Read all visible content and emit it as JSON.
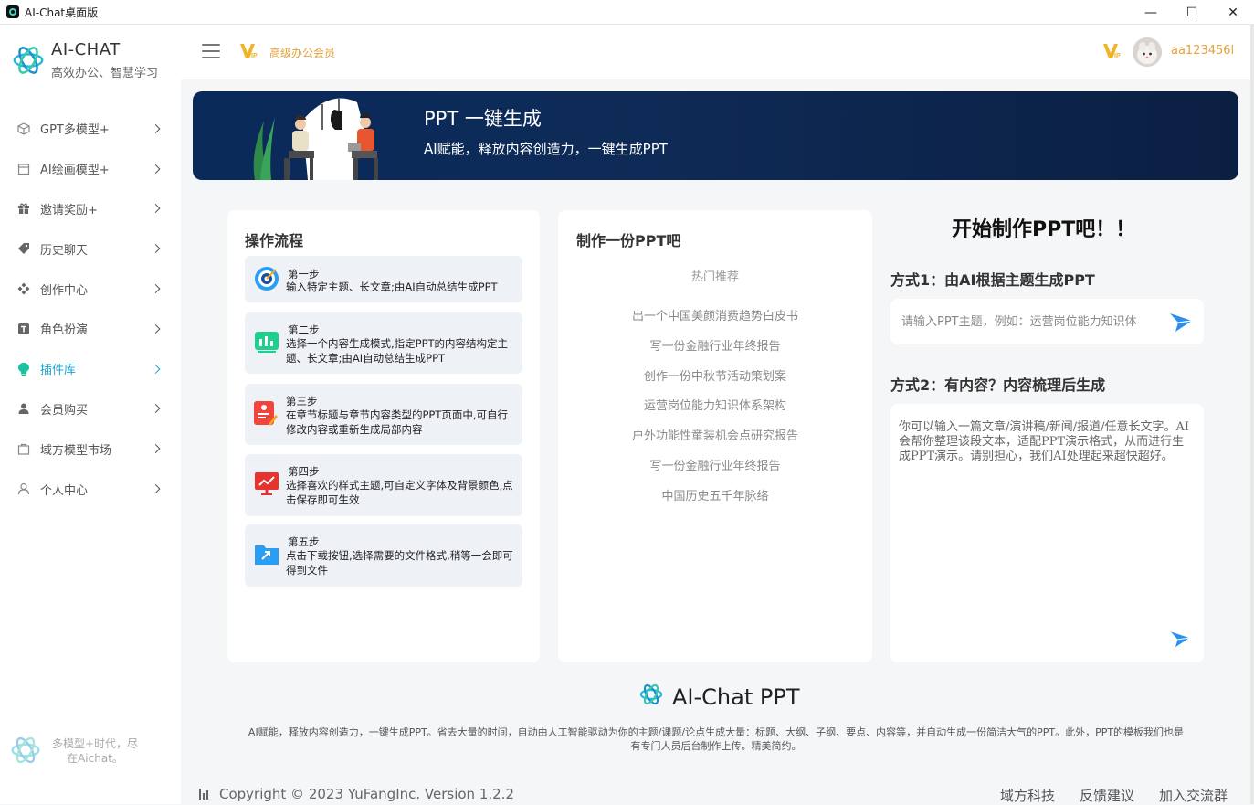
{
  "window": {
    "title": "AI-Chat桌面版",
    "minimize_glyph": "—",
    "maximize_glyph": "☐",
    "close_glyph": "✕"
  },
  "brand": {
    "name": "AI-CHAT",
    "slogan": "高效办公、智慧学习"
  },
  "sidebar": {
    "items": [
      {
        "label": "GPT多模型+",
        "icon": "cube-icon"
      },
      {
        "label": "AI绘画模型+",
        "icon": "calendar-icon"
      },
      {
        "label": "邀请奖励+",
        "icon": "gift-icon"
      },
      {
        "label": "历史聊天",
        "icon": "tag-icon"
      },
      {
        "label": "创作中心",
        "icon": "diamond-grid-icon"
      },
      {
        "label": "角色扮演",
        "icon": "t-box-icon"
      },
      {
        "label": "插件库",
        "icon": "bulb-icon",
        "active": true
      },
      {
        "label": "会员购买",
        "icon": "user-icon"
      },
      {
        "label": "域方模型市场",
        "icon": "bag-icon"
      },
      {
        "label": "个人中心",
        "icon": "person-outline-icon"
      }
    ],
    "footer_text": "多模型+时代，尽在Aichat。"
  },
  "topbar": {
    "member_label": "高级办公会员",
    "username": "aa123456l"
  },
  "banner": {
    "title": "PPT 一键生成",
    "subtitle": "AI赋能，释放内容创造力，一键生成PPT"
  },
  "process": {
    "title": "操作流程",
    "steps": [
      {
        "head": "第一步",
        "body": "输入特定主题、长文章;由AI自动总结生成PPT"
      },
      {
        "head": "第二步",
        "body": "选择一个内容生成模式,指定PPT的内容结构定主题、长文章;由AI自动总结生成PPT"
      },
      {
        "head": "第三步",
        "body": "在章节标题与章节内容类型的PPT页面中,可自行修改内容或重新生成局部内容"
      },
      {
        "head": "第四步",
        "body": "选择喜欢的样式主题,可自定义字体及背景颜色,点击保存即可生效"
      },
      {
        "head": "第五步",
        "body": "点击下载按钮,选择需要的文件格式,稍等一会即可得到文件"
      }
    ]
  },
  "recommend": {
    "title": "制作一份PPT吧",
    "hot_label": "热门推荐",
    "items": [
      "出一个中国美颜消费趋势白皮书",
      "写一份金融行业年终报告",
      "创作一份中秋节活动策划案",
      "运营岗位能力知识体系架构",
      "户外功能性童装机会点研究报告",
      "写一份金融行业年终报告",
      "中国历史五千年脉络"
    ]
  },
  "start": {
    "title": "开始制作PPT吧！！",
    "method1": "方式1：由AI根据主题生成PPT",
    "input_placeholder": "请输入PPT主题，例如：运营岗位能力知识体",
    "method2": "方式2：有内容？内容梳理后生成",
    "textarea_placeholder": "你可以输入一篇文章/演讲稿/新闻/报道/任意长文字。AI会帮你整理该段文本，适配PPT演示格式，从而进行生成PPT演示。请别担心，我们AI处理起来超快超好。"
  },
  "footer": {
    "brand": "AI-Chat PPT",
    "description": "AI赋能，释放内容创造力，一键生成PPT。省去大量的时间，自动由人工智能驱动为你的主题/课题/论点生成大量：标题、大纲、子纲、要点、内容等，并自动生成一份简洁大气的PPT。此外，PPT的模板我们也是有专门人员后台制作上传。精美简约。",
    "copyright": "Copyright © 2023 YuFangInc. Version 1.2.2",
    "links": [
      "域方科技",
      "反馈建议",
      "加入交流群"
    ]
  },
  "colors": {
    "accent": "#1ba7d6",
    "gold": "#e6a23c",
    "banner": "#0e2b57"
  }
}
